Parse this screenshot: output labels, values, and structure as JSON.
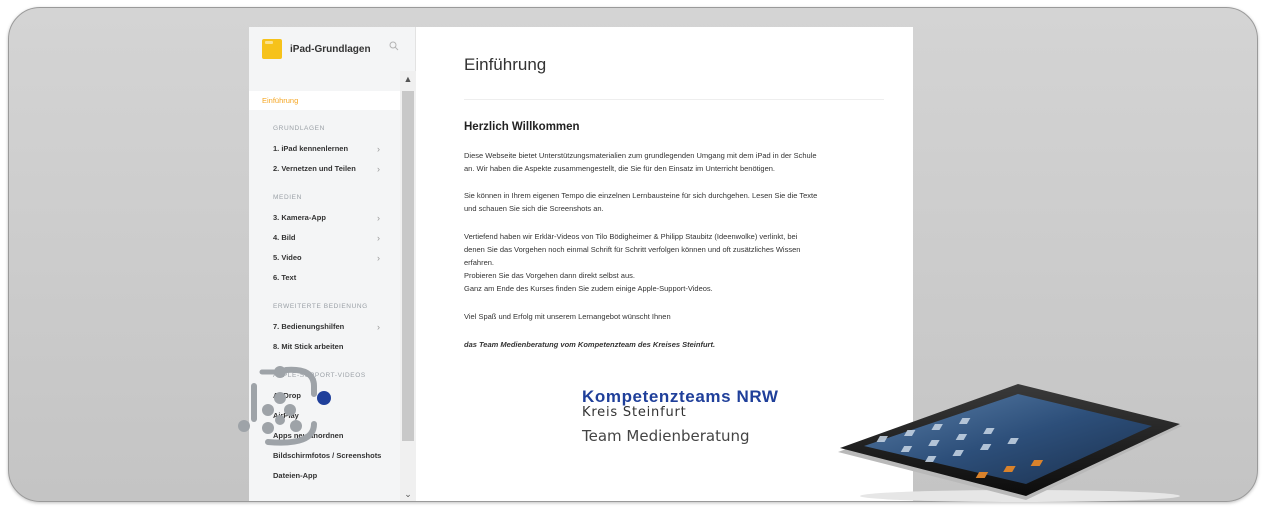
{
  "sidebar": {
    "title": "iPad-Grundlagen",
    "active_item": "Einführung",
    "sections": [
      {
        "label": "GRUNDLAGEN",
        "items": [
          {
            "label": "1. iPad kennenlernen",
            "chevron": true
          },
          {
            "label": "2. Vernetzen und Teilen",
            "chevron": true
          }
        ]
      },
      {
        "label": "MEDIEN",
        "items": [
          {
            "label": "3. Kamera-App",
            "chevron": true
          },
          {
            "label": "4. Bild",
            "chevron": true
          },
          {
            "label": "5. Video",
            "chevron": true
          },
          {
            "label": "6. Text",
            "chevron": false
          }
        ]
      },
      {
        "label": "ERWEITERTE BEDIENUNG",
        "items": [
          {
            "label": "7. Bedienungshilfen",
            "chevron": true
          },
          {
            "label": "8. Mit Stick arbeiten",
            "chevron": false
          }
        ]
      },
      {
        "label": "APPLE-SUPPORT-VIDEOS",
        "items": [
          {
            "label": "AirDrop",
            "chevron": false
          },
          {
            "label": "AirPlay",
            "chevron": false
          },
          {
            "label": "Apps neu anordnen",
            "chevron": false
          },
          {
            "label": "Bildschirmfotos / Screenshots",
            "chevron": false
          },
          {
            "label": "Dateien-App",
            "chevron": false
          }
        ]
      }
    ]
  },
  "content": {
    "title": "Einführung",
    "subtitle": "Herzlich Willkommen",
    "p1": [
      "Diese Webseite bietet Unterstützungsmaterialien zum grundlegenden Umgang mit dem iPad in der Schule",
      "an. Wir haben die Aspekte zusammengestellt, die Sie für den Einsatz im Unterricht benötigen."
    ],
    "p2": [
      "Sie können in Ihrem eigenen Tempo die einzelnen Lernbausteine für sich durchgehen. Lesen Sie die Texte",
      "und schauen Sie sich die Screenshots an."
    ],
    "p3": [
      "Vertiefend haben wir Erklär-Videos  von Tilo Bödigheimer & Philipp Staubitz (Ideenwolke) verlinkt,  bei",
      "denen Sie das Vorgehen noch einmal Schrift für Schritt verfolgen können und oft zusätzliches Wissen",
      "erfahren.",
      "Probieren Sie das Vorgehen dann direkt selbst aus.",
      "Ganz am Ende des Kurses finden Sie zudem einige Apple-Support-Videos."
    ],
    "p4": "Viel Spaß und Erfolg mit unserem Lernangebot wünscht Ihnen",
    "p5": "das Team Medienberatung vom Kompetenzteam des Kreises Steinfurt."
  },
  "logo": {
    "title": "Kompetenzteams NRW",
    "line1": "Kreis Steinfurt",
    "line2": "Team Medienberatung"
  },
  "colors": {
    "accent": "#f5a623",
    "logo_blue": "#1f3f9a",
    "logo_gray": "#9ea3a8"
  },
  "icons": {
    "search": "search-icon",
    "scroll_up": "chevron-up-icon",
    "scroll_down": "chevron-down-icon",
    "chevron": "chevron-right-icon"
  }
}
